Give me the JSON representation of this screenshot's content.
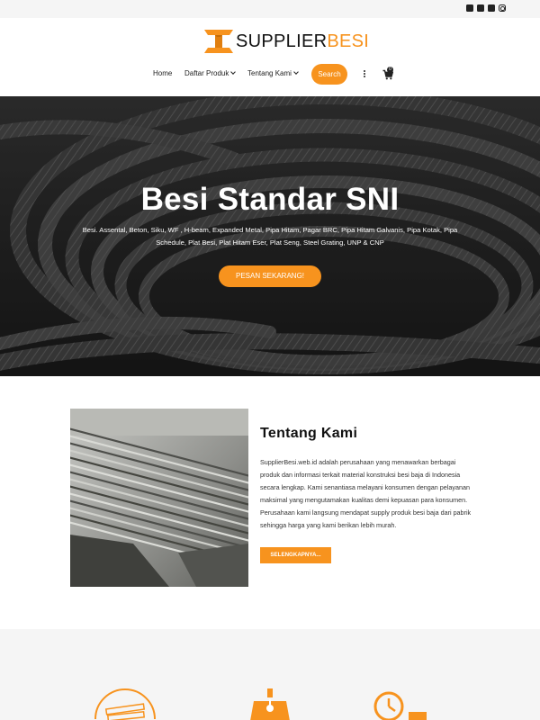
{
  "topbar": {
    "social_icons": [
      "facebook-icon",
      "twitter-icon",
      "linkedin-icon",
      "instagram-icon"
    ]
  },
  "header": {
    "logo_part1": "SUPPLIER",
    "logo_part2": "BESI",
    "nav": {
      "home": "Home",
      "products": "Daftar Produk",
      "about": "Tentang Kami",
      "search": "Search",
      "cart_count": "0"
    }
  },
  "hero": {
    "title": "Besi Standar SNI",
    "subtitle": "Besi. Assental, Beton, Siku, WF , H-beam, Expanded Metal, Pipa Hitam, Pagar BRC, Pipa Hitam Galvanis, Pipa Kotak, Pipa Schedule, Plat Besi, Plat Hitam Eser, Plat Seng, Steel Grating, UNP & CNP",
    "cta": "PESAN SEKARANG!"
  },
  "about": {
    "title": "Tentang Kami",
    "text": "SupplierBesi.web.id adalah perusahaan yang menawarkan berbagai produk dan informasi terkait material konstruksi besi baja di Indonesia secara lengkap. Kami senantiasa melayani konsumen dengan pelayanan maksimal yang mengutamakan kualitas demi kepuasan para konsumen. Perusahaan kami langsung mendapat supply produk besi baja dari pabrik sehingga harga yang kami berikan lebih murah.",
    "button": "SELENGKAPNYA..."
  },
  "features": {
    "icons": [
      "steel-bars-icon",
      "factory-hook-icon",
      "fast-delivery-icon"
    ]
  },
  "colors": {
    "accent": "#f7931e",
    "text_dark": "#111111",
    "light_bg": "#f5f5f5"
  }
}
